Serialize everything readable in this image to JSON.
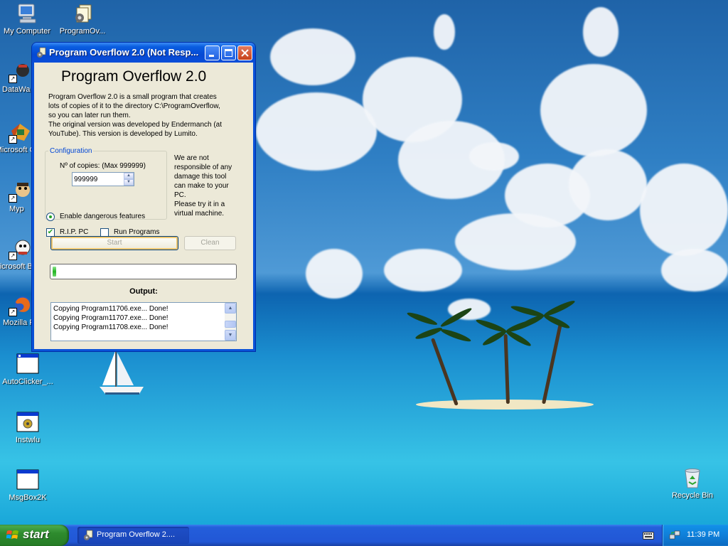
{
  "desktop": {
    "icons": [
      {
        "label": "My Computer",
        "icon": "computer-icon"
      },
      {
        "label": "ProgramOv...",
        "icon": "program-overflow-icon"
      },
      {
        "label": "DataWa",
        "icon": "shortcut-icon"
      },
      {
        "label": "Microsoft C++",
        "icon": "shortcut-icon"
      },
      {
        "label": "Myp",
        "icon": "shortcut-icon"
      },
      {
        "label": "Microsoft Basic",
        "icon": "shortcut-icon"
      },
      {
        "label": "Mozilla F",
        "icon": "firefox-icon"
      },
      {
        "label": "AutoClicker_...",
        "icon": "application-icon"
      },
      {
        "label": "Instwlu",
        "icon": "application-icon"
      },
      {
        "label": "MsgBox2K",
        "icon": "application-icon"
      },
      {
        "label": "Recycle Bin",
        "icon": "recycle-bin-icon"
      }
    ]
  },
  "window": {
    "title": "Program Overflow 2.0 (Not Resp...",
    "heading": "Program Overflow 2.0",
    "description": [
      "Program Overflow 2.0 is a small program that creates",
      "lots of copies of it to the directory C:\\ProgramOverflow,",
      "so you can later run them.",
      "The original version was developed by Endermanch (at",
      "YouTube). This version is developed by Lumito."
    ],
    "config_title": "Configuration",
    "copies_label": "Nº of copies: (Max 999999)",
    "copies_value": "999999",
    "dangerous_label": "Enable dangerous features",
    "rip_label": "R.I.P. PC",
    "rip_checked": true,
    "run_programs_label": "Run Programs",
    "run_programs_checked": false,
    "warning": [
      "We are not",
      "responsible of any",
      "damage this tool",
      "can make to your",
      "PC.",
      "Please try it in a",
      "virtual machine."
    ],
    "start_label": "Start",
    "clean_label": "Clean",
    "progress_fraction": 0.02,
    "output_label": "Output:",
    "output_lines": [
      "Copying Program11706.exe... Done!",
      "Copying Program11707.exe... Done!",
      "Copying Program11708.exe... Done!"
    ]
  },
  "taskbar": {
    "start_label": "start",
    "task_label": "Program Overflow 2....",
    "clock": "11:39 PM"
  },
  "colors": {
    "titlebar": "#0a5ee0",
    "window_bg": "#ece9d8",
    "taskbar": "#245edb",
    "start_button": "#2e8b2e",
    "progress": "#22b422"
  }
}
